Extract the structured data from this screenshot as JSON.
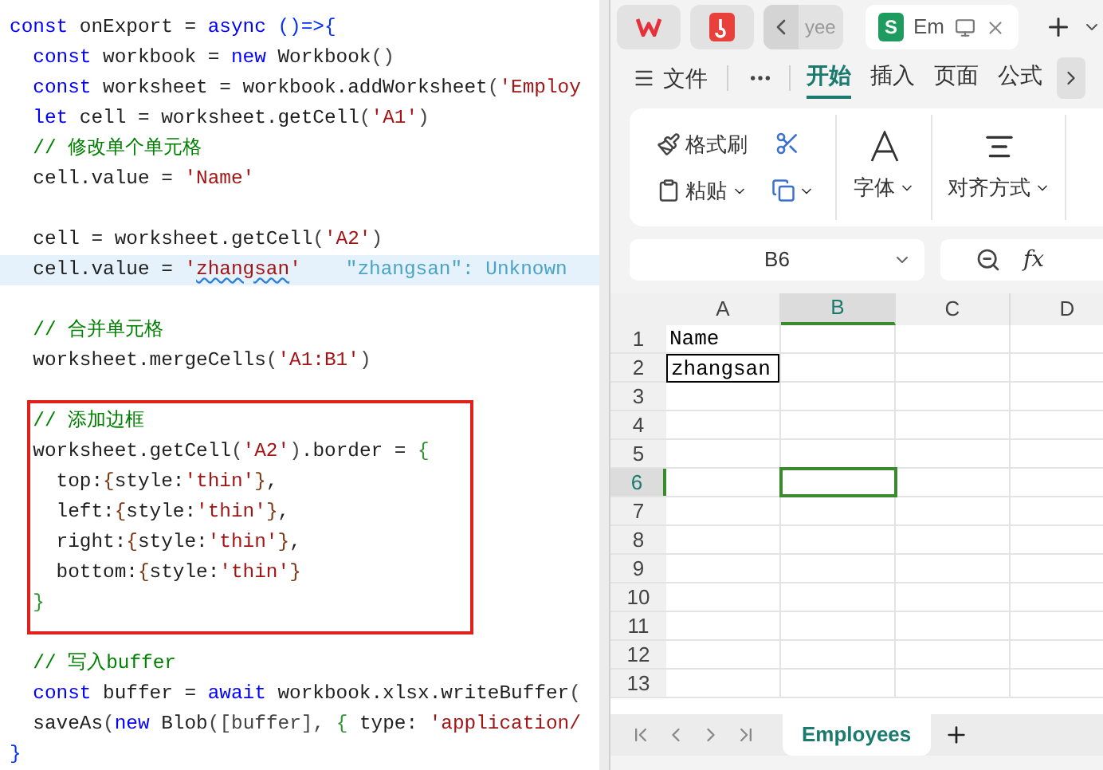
{
  "editor": {
    "sections": [
      {
        "kind": "plain",
        "lines": [
          {
            "kind": "code",
            "highlighted": false,
            "tokens": [
              {
                "kind": "kw",
                "text": "const"
              },
              {
                "kind": "id",
                "text": " onExport = "
              },
              {
                "kind": "kw",
                "text": "async"
              },
              {
                "kind": "b1",
                "text": " ()=>{"
              }
            ]
          },
          {
            "kind": "code",
            "highlighted": false,
            "tokens": [
              {
                "kind": "kw",
                "text": "  const"
              },
              {
                "kind": "id",
                "text": " workbook = "
              },
              {
                "kind": "kw",
                "text": "new"
              },
              {
                "kind": "id",
                "text": " Workbook"
              },
              {
                "kind": "p",
                "text": "()"
              }
            ]
          },
          {
            "kind": "code",
            "highlighted": false,
            "tokens": [
              {
                "kind": "kw",
                "text": "  const"
              },
              {
                "kind": "id",
                "text": " worksheet = workbook.addWorksheet"
              },
              {
                "kind": "p",
                "text": "("
              },
              {
                "kind": "str",
                "text": "'Employ"
              }
            ]
          },
          {
            "kind": "code",
            "highlighted": false,
            "tokens": [
              {
                "kind": "kw",
                "text": "  let"
              },
              {
                "kind": "id",
                "text": " cell = worksheet.getCell"
              },
              {
                "kind": "p",
                "text": "("
              },
              {
                "kind": "str",
                "text": "'A1'"
              },
              {
                "kind": "p",
                "text": ")"
              }
            ]
          },
          {
            "kind": "code",
            "highlighted": false,
            "tokens": [
              {
                "kind": "com",
                "text": "  // 修改单个单元格"
              }
            ]
          },
          {
            "kind": "code",
            "highlighted": false,
            "tokens": [
              {
                "kind": "id",
                "text": "  cell.value = "
              },
              {
                "kind": "str",
                "text": "'Name'"
              }
            ]
          },
          {
            "kind": "blank",
            "highlighted": false
          },
          {
            "kind": "code",
            "highlighted": false,
            "tokens": [
              {
                "kind": "id",
                "text": "  cell = worksheet.getCell"
              },
              {
                "kind": "p",
                "text": "("
              },
              {
                "kind": "str",
                "text": "'A2'"
              },
              {
                "kind": "p",
                "text": ")"
              }
            ]
          },
          {
            "kind": "code",
            "highlighted": true,
            "tokens": [
              {
                "kind": "id",
                "text": "  cell.value = "
              },
              {
                "kind": "str",
                "text": "'"
              },
              {
                "kind": "warn",
                "text": "zhangsan"
              },
              {
                "kind": "str",
                "text": "'"
              }
            ],
            "hint": "\"zhangsan\": Unknown"
          },
          {
            "kind": "blank",
            "highlighted": false
          },
          {
            "kind": "code",
            "highlighted": false,
            "tokens": [
              {
                "kind": "com",
                "text": "  // 合并单元格"
              }
            ]
          },
          {
            "kind": "code",
            "highlighted": false,
            "tokens": [
              {
                "kind": "id",
                "text": "  worksheet.mergeCells"
              },
              {
                "kind": "p",
                "text": "("
              },
              {
                "kind": "str",
                "text": "'A1:B1'"
              },
              {
                "kind": "p",
                "text": ")"
              }
            ]
          },
          {
            "kind": "blank",
            "highlighted": false
          }
        ]
      },
      {
        "kind": "boxed",
        "lines": [
          {
            "kind": "code",
            "highlighted": false,
            "tokens": [
              {
                "kind": "com",
                "text": "  // 添加边框"
              }
            ]
          },
          {
            "kind": "code",
            "highlighted": false,
            "tokens": [
              {
                "kind": "id",
                "text": "  worksheet.getCell"
              },
              {
                "kind": "p",
                "text": "("
              },
              {
                "kind": "str",
                "text": "'A2'"
              },
              {
                "kind": "p",
                "text": ")"
              },
              {
                "kind": "id",
                "text": ".border = "
              },
              {
                "kind": "b2",
                "text": "{"
              }
            ]
          },
          {
            "kind": "code",
            "highlighted": false,
            "tokens": [
              {
                "kind": "id",
                "text": "    top:"
              },
              {
                "kind": "b3",
                "text": "{"
              },
              {
                "kind": "id",
                "text": "style:"
              },
              {
                "kind": "str",
                "text": "'thin'"
              },
              {
                "kind": "b3",
                "text": "}"
              },
              {
                "kind": "id",
                "text": ","
              }
            ]
          },
          {
            "kind": "code",
            "highlighted": false,
            "tokens": [
              {
                "kind": "id",
                "text": "    left:"
              },
              {
                "kind": "b3",
                "text": "{"
              },
              {
                "kind": "id",
                "text": "style:"
              },
              {
                "kind": "str",
                "text": "'thin'"
              },
              {
                "kind": "b3",
                "text": "}"
              },
              {
                "kind": "id",
                "text": ","
              }
            ]
          },
          {
            "kind": "code",
            "highlighted": false,
            "tokens": [
              {
                "kind": "id",
                "text": "    right:"
              },
              {
                "kind": "b3",
                "text": "{"
              },
              {
                "kind": "id",
                "text": "style:"
              },
              {
                "kind": "str",
                "text": "'thin'"
              },
              {
                "kind": "b3",
                "text": "}"
              },
              {
                "kind": "id",
                "text": ","
              }
            ]
          },
          {
            "kind": "code",
            "highlighted": false,
            "tokens": [
              {
                "kind": "id",
                "text": "    bottom:"
              },
              {
                "kind": "b3",
                "text": "{"
              },
              {
                "kind": "id",
                "text": "style:"
              },
              {
                "kind": "str",
                "text": "'thin'"
              },
              {
                "kind": "b3",
                "text": "}"
              }
            ]
          },
          {
            "kind": "code",
            "highlighted": false,
            "tokens": [
              {
                "kind": "b2",
                "text": "  }"
              }
            ]
          }
        ]
      },
      {
        "kind": "plain",
        "lines": [
          {
            "kind": "blank",
            "highlighted": false
          },
          {
            "kind": "code",
            "highlighted": false,
            "tokens": [
              {
                "kind": "com",
                "text": "  // 写入buffer"
              }
            ]
          },
          {
            "kind": "code",
            "highlighted": false,
            "tokens": [
              {
                "kind": "kw",
                "text": "  const"
              },
              {
                "kind": "id",
                "text": " buffer = "
              },
              {
                "kind": "kw",
                "text": "await"
              },
              {
                "kind": "id",
                "text": " workbook.xlsx.writeBuffer"
              },
              {
                "kind": "p",
                "text": "("
              }
            ]
          },
          {
            "kind": "code",
            "highlighted": false,
            "tokens": [
              {
                "kind": "id",
                "text": "  saveAs"
              },
              {
                "kind": "p",
                "text": "("
              },
              {
                "kind": "kw",
                "text": "new"
              },
              {
                "kind": "id",
                "text": " Blob"
              },
              {
                "kind": "p",
                "text": "([buffer], "
              },
              {
                "kind": "b2",
                "text": "{"
              },
              {
                "kind": "id",
                "text": " type: "
              },
              {
                "kind": "str",
                "text": "'application/"
              }
            ]
          },
          {
            "kind": "code",
            "highlighted": false,
            "tokens": [
              {
                "kind": "b1",
                "text": "}"
              }
            ]
          }
        ]
      }
    ]
  },
  "spreadsheet": {
    "app_tabs": [
      {
        "kind": "wps",
        "selected": false
      },
      {
        "kind": "pdf",
        "selected": false
      },
      {
        "kind": "doc",
        "label": "yee",
        "selected": false
      },
      {
        "kind": "sheet",
        "badge": "S",
        "label": "Em",
        "selected": true
      }
    ],
    "file_menu": "文件",
    "ribbon_tabs": [
      {
        "label": "开始",
        "selected": true
      },
      {
        "label": "插入",
        "selected": false
      },
      {
        "label": "页面",
        "selected": false
      },
      {
        "label": "公式",
        "selected": false
      }
    ],
    "ribbon": {
      "format_painter": "格式刷",
      "paste": "粘贴",
      "font": "字体",
      "alignment": "对齐方式"
    },
    "name_box": "B6",
    "formula_label": "fx",
    "columns": [
      {
        "label": "A",
        "selected": false
      },
      {
        "label": "B",
        "selected": true
      },
      {
        "label": "C",
        "selected": false
      },
      {
        "label": "D",
        "selected": false
      }
    ],
    "rows": [
      {
        "label": "1",
        "selected": false,
        "cell_a": "Name",
        "bordered": false
      },
      {
        "label": "2",
        "selected": false,
        "cell_a": "zhangsan",
        "bordered": true
      },
      {
        "label": "3",
        "selected": false
      },
      {
        "label": "4",
        "selected": false
      },
      {
        "label": "5",
        "selected": false
      },
      {
        "label": "6",
        "selected": true
      },
      {
        "label": "7",
        "selected": false
      },
      {
        "label": "8",
        "selected": false
      },
      {
        "label": "9",
        "selected": false
      },
      {
        "label": "10",
        "selected": false
      },
      {
        "label": "11",
        "selected": false
      },
      {
        "label": "12",
        "selected": false
      },
      {
        "label": "13",
        "selected": false
      }
    ],
    "sheet_tabs": [
      {
        "label": "Employees",
        "selected": true
      }
    ]
  }
}
